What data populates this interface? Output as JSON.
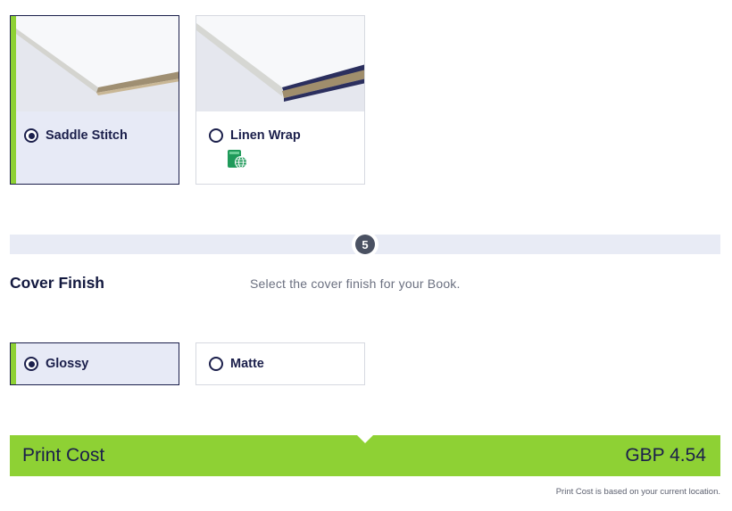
{
  "binding": {
    "options": [
      {
        "label": "Saddle Stitch",
        "selected": true
      },
      {
        "label": "Linen Wrap",
        "selected": false,
        "icon": "web-book-icon"
      }
    ]
  },
  "step": {
    "number": "5"
  },
  "cover_finish": {
    "title": "Cover Finish",
    "description": "Select the cover finish for your Book.",
    "options": [
      {
        "label": "Glossy",
        "selected": true
      },
      {
        "label": "Matte",
        "selected": false
      }
    ]
  },
  "print_cost": {
    "label": "Print Cost",
    "value": "GBP 4.54",
    "note": "Print Cost is based on your current location."
  },
  "colors": {
    "accent_green": "#8ed134",
    "navy": "#1b1f4b",
    "selected_bg": "#e7eaf6",
    "icon_green": "#1f9a5a"
  }
}
